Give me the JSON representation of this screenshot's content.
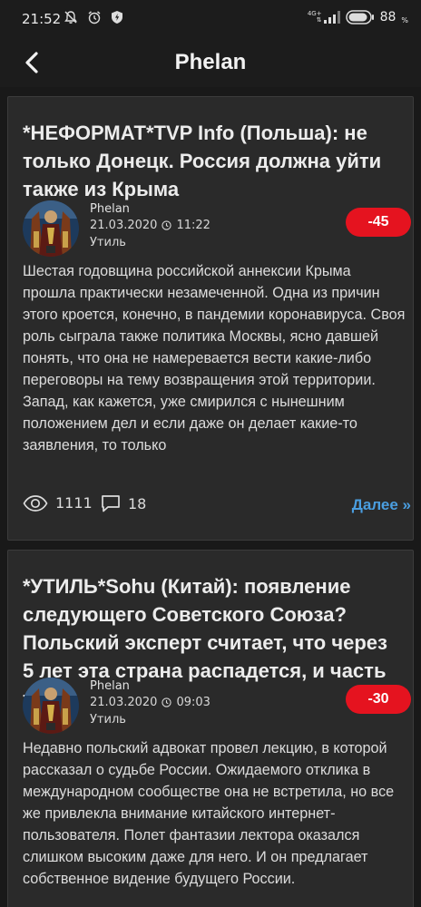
{
  "status": {
    "time": "21:52",
    "network": "4G+",
    "battery": "88",
    "battery_unit": "%"
  },
  "header": {
    "title": "Phelan",
    "back_icon": "back-arrow-icon"
  },
  "posts": [
    {
      "title": "*НЕФОРМАТ*TVP Info (Польша): не только Донецк. Россия должна уйти также из Крыма",
      "author": "Phelan",
      "date": "21.03.2020",
      "time": "11:22",
      "category": "Утиль",
      "rating": "-45",
      "excerpt": "Шестая годовщина российской аннексии Крыма прошла практически незамеченной. Одна из причин этого кроется, конечно, в пандемии коронавируса. Своя роль сыграла также политика Москвы, ясно давшей понять, что она не намеревается вести какие-либо переговоры на тему возвращения этой территории. Запад, как кажется, уже смирился с нынешним положением дел и если даже он делает какие-то заявления, то только",
      "views": "1111",
      "comments": "18",
      "more_label": "Далее »"
    },
    {
      "title": "*УТИЛЬ*Sohu (Китай): появление следующего Советского Союза? Польский эксперт считает, что через 5 лет эта страна распадется, и часть те",
      "author": "Phelan",
      "date": "21.03.2020",
      "time": "09:03",
      "category": "Утиль",
      "rating": "-30",
      "excerpt": "Недавно польский адвокат провел лекцию, в которой рассказал о судьбе России. Ожидаемого отклика в международном сообществе она не встретила, но все же привлекла внимание китайского интернет-пользователя. Полет фантазии лектора оказался слишком высоким даже для него. И он предлагает собственное видение будущего России."
    }
  ],
  "colors": {
    "background": "#191919",
    "card": "#2a2a2a",
    "rating_badge": "#e5131f",
    "link": "#4a9ee0"
  }
}
